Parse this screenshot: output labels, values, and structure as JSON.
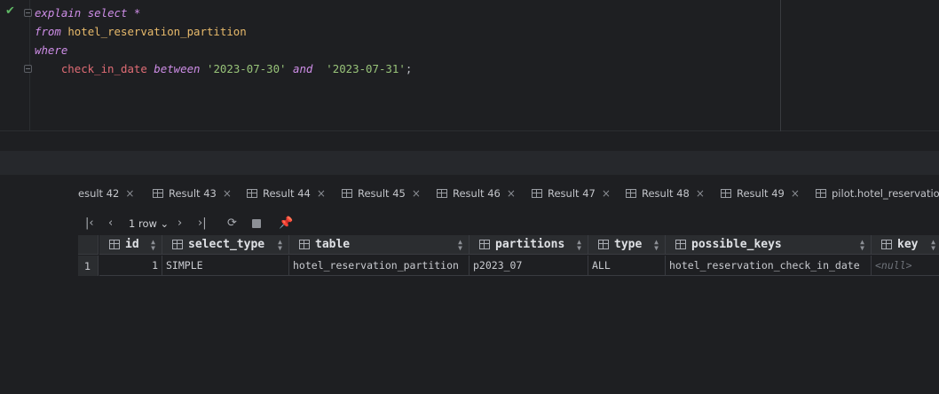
{
  "editor": {
    "lines": [
      [
        {
          "t": "explain",
          "c": "kw"
        },
        {
          "t": " ",
          "c": "txt"
        },
        {
          "t": "select",
          "c": "kw"
        },
        {
          "t": " ",
          "c": "txt"
        },
        {
          "t": "*",
          "c": "kw"
        }
      ],
      [
        {
          "t": "from",
          "c": "kw"
        },
        {
          "t": " ",
          "c": "txt"
        },
        {
          "t": "hotel_reservation_partition",
          "c": "tbl"
        }
      ],
      [
        {
          "t": "where",
          "c": "kw"
        }
      ],
      [
        {
          "t": "    ",
          "c": "txt"
        },
        {
          "t": "check_in_date",
          "c": "col"
        },
        {
          "t": " ",
          "c": "txt"
        },
        {
          "t": "between",
          "c": "kw"
        },
        {
          "t": " ",
          "c": "txt"
        },
        {
          "t": "'2023-07-30'",
          "c": "str"
        },
        {
          "t": " ",
          "c": "txt"
        },
        {
          "t": "and",
          "c": "kw"
        },
        {
          "t": "  ",
          "c": "txt"
        },
        {
          "t": "'2023-07-31'",
          "c": "str"
        },
        {
          "t": ";",
          "c": "txt"
        }
      ]
    ]
  },
  "result_tabs": [
    {
      "label": "esult 42",
      "icon": false
    },
    {
      "label": "Result 43",
      "icon": true
    },
    {
      "label": "Result 44",
      "icon": true
    },
    {
      "label": "Result 45",
      "icon": true
    },
    {
      "label": "Result 46",
      "icon": true
    },
    {
      "label": "Result 47",
      "icon": true
    },
    {
      "label": "Result 48",
      "icon": true
    },
    {
      "label": "Result 49",
      "icon": true
    },
    {
      "label": "pilot.hotel_reservation_",
      "icon": true
    }
  ],
  "toolbar": {
    "rows_label": "1 row"
  },
  "grid": {
    "columns": [
      "id",
      "select_type",
      "table",
      "partitions",
      "type",
      "possible_keys",
      "key"
    ],
    "rows": [
      {
        "num": "1",
        "cells": [
          "1",
          "SIMPLE",
          "hotel_reservation_partition",
          "p2023_07",
          "ALL",
          "hotel_reservation_check_in_date",
          "<null>"
        ]
      }
    ]
  },
  "icons": {
    "status": "check-icon",
    "first": "first-page-icon",
    "prev": "prev-page-icon",
    "next": "next-page-icon",
    "last": "last-page-icon",
    "reload": "reload-icon",
    "stop": "stop-icon",
    "pin": "pin-icon"
  },
  "colors": {
    "keyword": "#cf8ee8",
    "table": "#e8ba6b",
    "column": "#e06c75",
    "string": "#98c379",
    "success": "#5fb865"
  }
}
